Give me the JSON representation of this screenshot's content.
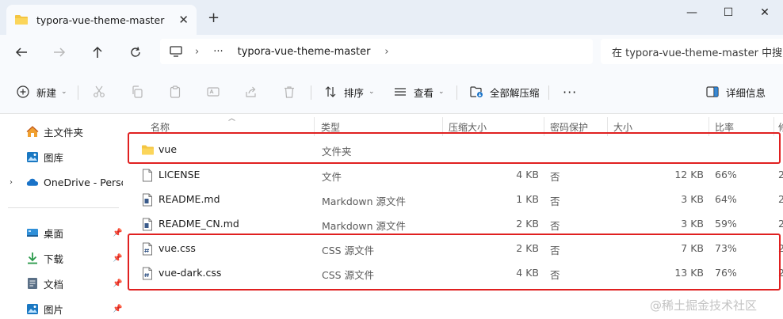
{
  "window": {
    "tab_title": "typora-vue-theme-master",
    "new_tab_symbol": "+",
    "close_symbol": "✕",
    "minimize_symbol": "—",
    "maximize_symbol": "☐",
    "window_close_symbol": "✕"
  },
  "address": {
    "ellipsis": "···",
    "path": "typora-vue-theme-master",
    "search_placeholder": "在 typora-vue-theme-master 中搜"
  },
  "commands": {
    "new_label": "新建",
    "sort_label": "排序",
    "view_label": "查看",
    "extract_label": "全部解压缩",
    "more_label": "···",
    "details_label": "详细信息"
  },
  "sidebar": {
    "items": [
      {
        "label": "主文件夹",
        "icon": "home-icon"
      },
      {
        "label": "图库",
        "icon": "gallery-icon"
      },
      {
        "label": "OneDrive - Perso",
        "icon": "cloud-icon"
      },
      {
        "label": "桌面",
        "icon": "desktop-icon"
      },
      {
        "label": "下载",
        "icon": "download-icon"
      },
      {
        "label": "文档",
        "icon": "document-icon"
      },
      {
        "label": "图片",
        "icon": "pictures-icon"
      }
    ]
  },
  "columns": {
    "name": "名称",
    "type": "类型",
    "compressed_size": "压缩大小",
    "password": "密码保护",
    "size": "大小",
    "ratio": "比率",
    "extra": "修"
  },
  "files": [
    {
      "name": "vue",
      "type": "文件夹",
      "compressed": "",
      "password": "",
      "size": "",
      "ratio": "",
      "extra": "",
      "kind": "folder"
    },
    {
      "name": "LICENSE",
      "type": "文件",
      "compressed": "4 KB",
      "password": "否",
      "size": "12 KB",
      "ratio": "66%",
      "extra": "2",
      "kind": "file"
    },
    {
      "name": "README.md",
      "type": "Markdown 源文件",
      "compressed": "1 KB",
      "password": "否",
      "size": "3 KB",
      "ratio": "64%",
      "extra": "2",
      "kind": "md"
    },
    {
      "name": "README_CN.md",
      "type": "Markdown 源文件",
      "compressed": "2 KB",
      "password": "否",
      "size": "3 KB",
      "ratio": "59%",
      "extra": "2",
      "kind": "md"
    },
    {
      "name": "vue.css",
      "type": "CSS 源文件",
      "compressed": "2 KB",
      "password": "否",
      "size": "7 KB",
      "ratio": "73%",
      "extra": "2",
      "kind": "css"
    },
    {
      "name": "vue-dark.css",
      "type": "CSS 源文件",
      "compressed": "4 KB",
      "password": "否",
      "size": "13 KB",
      "ratio": "76%",
      "extra": "2",
      "kind": "css"
    }
  ],
  "watermark": "@稀土掘金技术社区",
  "colors": {
    "titlebar": "#e8eef6",
    "highlight": "#e02020",
    "folder": "#f4c542"
  }
}
